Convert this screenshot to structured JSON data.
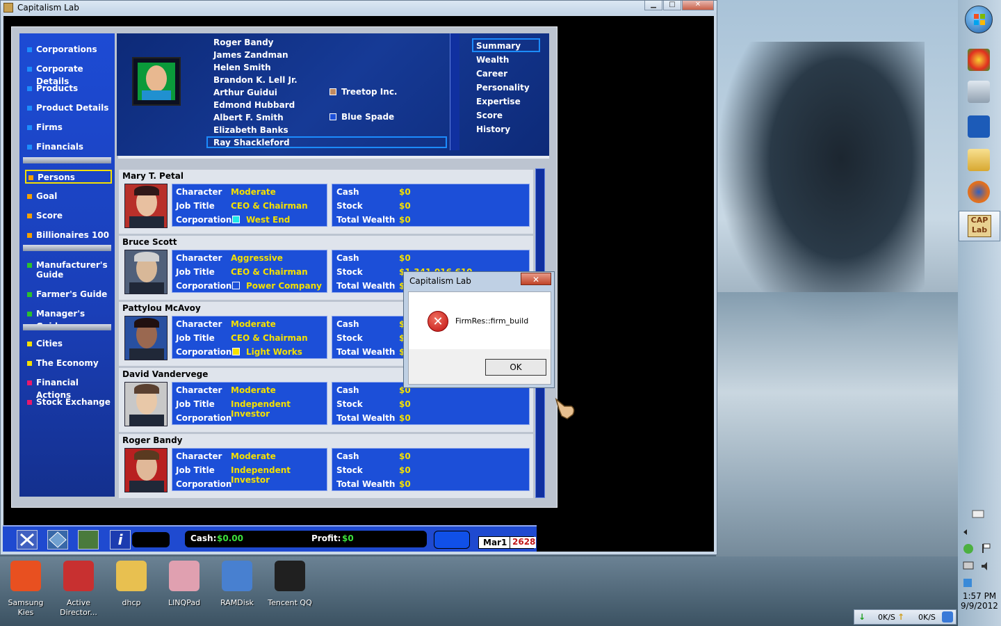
{
  "window": {
    "title": "Capitalism Lab",
    "min": "▁",
    "max": "□",
    "close": "✕"
  },
  "nav": {
    "items": [
      {
        "label": "Corporations",
        "color": "#1c8cff"
      },
      {
        "label": "Corporate Details",
        "color": "#1c8cff"
      },
      {
        "label": "Products",
        "color": "#1c8cff"
      },
      {
        "label": "Product Details",
        "color": "#1c8cff"
      },
      {
        "label": "Firms",
        "color": "#1c8cff"
      },
      {
        "label": "Financials",
        "color": "#1c8cff"
      },
      {
        "label": "Persons",
        "color": "#f4a000"
      },
      {
        "label": "Goal",
        "color": "#f4a000"
      },
      {
        "label": "Score",
        "color": "#f4a000"
      },
      {
        "label": "Billionaires 100",
        "color": "#f4a000"
      },
      {
        "label": "Manufacturer's Guide",
        "color": "#2cc02c"
      },
      {
        "label": "Farmer's Guide",
        "color": "#2cc02c"
      },
      {
        "label": "Manager's Guide",
        "color": "#2cc02c"
      },
      {
        "label": "Cities",
        "color": "#f4e000"
      },
      {
        "label": "The Economy",
        "color": "#f4e000"
      },
      {
        "label": "Financial Actions",
        "color": "#e8186c"
      },
      {
        "label": "Stock Exchange",
        "color": "#e8186c"
      }
    ]
  },
  "person_list": [
    "Roger Bandy",
    "James Zandman",
    "Helen Smith",
    "Brandon K. Lell Jr.",
    "Arthur Guidui",
    "Edmond Hubbard",
    "Albert F. Smith",
    "Elizabeth Banks",
    "Ray Shackleford"
  ],
  "legend": [
    {
      "label": "Treetop Inc.",
      "color": "#c08a60"
    },
    {
      "label": "Blue Spade",
      "color": "#1c4fd8"
    }
  ],
  "tabs": [
    "Summary",
    "Wealth",
    "Career",
    "Personality",
    "Expertise",
    "Score",
    "History"
  ],
  "field_labels": {
    "character": "Character",
    "job_title": "Job Title",
    "corporation": "Corporation",
    "cash": "Cash",
    "stock": "Stock",
    "total_wealth": "Total Wealth"
  },
  "persons": [
    {
      "name": "Mary T. Petal",
      "character": "Moderate",
      "job_title": "CEO & Chairman",
      "corporation": "West End",
      "corp_color": "#20e8e8",
      "cash": "$0",
      "stock": "$0",
      "total_wealth": "$0"
    },
    {
      "name": "Bruce Scott",
      "character": "Aggressive",
      "job_title": "CEO & Chairman",
      "corporation": "Power Company",
      "corp_color": "#1c4fd8",
      "cash": "$0",
      "stock": "$1,341,016,610",
      "total_wealth": "$"
    },
    {
      "name": "Pattylou McAvoy",
      "character": "Moderate",
      "job_title": "CEO & Chairman",
      "corporation": "Light Works",
      "corp_color": "#f4e000",
      "cash": "$",
      "stock": "$",
      "total_wealth": "$"
    },
    {
      "name": "David Vandervege",
      "character": "Moderate",
      "job_title": "Independent Investor",
      "corporation": "",
      "corp_color": "",
      "cash": "$0",
      "stock": "$0",
      "total_wealth": "$0"
    },
    {
      "name": "Roger Bandy",
      "character": "Moderate",
      "job_title": "Independent Investor",
      "corporation": "",
      "corp_color": "",
      "cash": "$0",
      "stock": "$0",
      "total_wealth": "$0"
    }
  ],
  "status_bar": {
    "cash_label": "Cash:",
    "cash_value": "$0.00",
    "profit_label": "Profit:",
    "profit_value": "$0",
    "date_month": "Mar",
    "date_day": "1",
    "date_year": "2628",
    "info_icon": "i"
  },
  "dialog": {
    "title": "Capitalism Lab",
    "message": "FirmRes::firm_build",
    "ok": "OK",
    "close": "✕",
    "icon": "✕"
  },
  "desktop_icons": [
    {
      "label": "Samsung Kies",
      "color": "#e85020"
    },
    {
      "label": "Active Director...",
      "color": "#c83030"
    },
    {
      "label": "dhcp",
      "color": "#e8c050"
    },
    {
      "label": "LINQPad",
      "color": "#e0a0b0"
    },
    {
      "label": "RAMDisk",
      "color": "#4880d0"
    },
    {
      "label": "Tencent QQ",
      "color": "#202020"
    }
  ],
  "taskbar": {
    "caplab_logo": "CAP Lab",
    "time": "1:57 PM",
    "date": "9/9/2012",
    "net_down": "0K/S",
    "net_up": "0K/S"
  }
}
